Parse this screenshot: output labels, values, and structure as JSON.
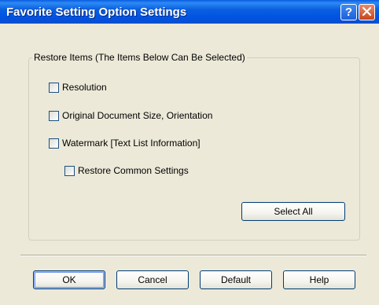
{
  "window": {
    "title": "Favorite Setting Option Settings",
    "help_icon": "question-mark-icon",
    "close_icon": "close-x-icon"
  },
  "group": {
    "label": "Restore Items (The Items Below Can Be Selected)",
    "options": [
      {
        "label": "Resolution",
        "checked": false
      },
      {
        "label": "Original Document Size, Orientation",
        "checked": false
      },
      {
        "label": "Watermark [Text List Information]",
        "checked": false
      },
      {
        "label": "Restore Common Settings",
        "checked": false
      }
    ],
    "select_all_label": "Select All"
  },
  "footer": {
    "ok_label": "OK",
    "cancel_label": "Cancel",
    "default_label": "Default",
    "help_label": "Help"
  },
  "colors": {
    "titlebar": "#0054e3",
    "dialog_bg": "#ece9d8",
    "close_button": "#c84618"
  }
}
